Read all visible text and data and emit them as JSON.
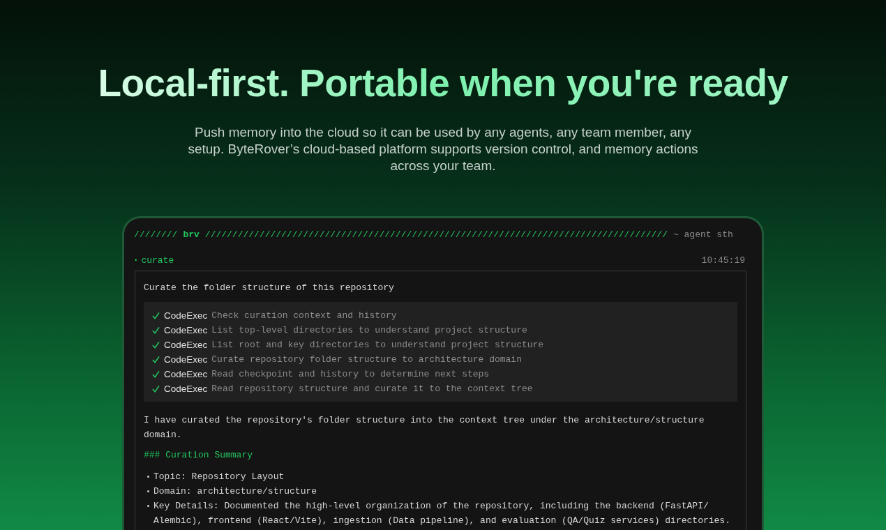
{
  "hero": {
    "headline": "Local-first. Portable when you're ready",
    "subtitle": "Push memory into the cloud so it can be used by any agents, any team member, any setup. ByteRover’s cloud-based platform supports version control, and memory actions across your team."
  },
  "terminal": {
    "header": {
      "left_rule": "////////",
      "brand": "brv",
      "right_rule": "/////////////////////////////////////////////////////////////////////////////////////",
      "session": "~ agent sth"
    },
    "command": {
      "bullet": "•",
      "name": "curate",
      "time": "10:45:19"
    },
    "prompt": "Curate the folder structure of this repository",
    "steps": [
      {
        "done": true,
        "tool": "CodeExec",
        "text": "Check curation context and history"
      },
      {
        "done": true,
        "tool": "CodeExec",
        "text": "List top-level directories to understand project structure"
      },
      {
        "done": true,
        "tool": "CodeExec",
        "text": "List root and key directories to understand project structure"
      },
      {
        "done": true,
        "tool": "CodeExec",
        "text": "Curate repository folder structure to architecture domain"
      },
      {
        "done": true,
        "tool": "CodeExec",
        "text": "Read checkpoint and history to determine next steps"
      },
      {
        "done": true,
        "tool": "CodeExec",
        "text": "Read repository structure and curate it to the context tree"
      }
    ],
    "response": "I have curated the repository's folder structure into the context tree under the architecture/structure domain.",
    "heading": "### Curation Summary",
    "bullets": [
      "Topic: Repository Layout",
      "Domain: architecture/structure",
      "Key Details: Documented the high-level organization of the repository, including the backend (FastAPI/ Alembic), frontend (React/Vite), ingestion (Data pipeline), and evaluation (QA/Quiz services) directories."
    ]
  }
}
